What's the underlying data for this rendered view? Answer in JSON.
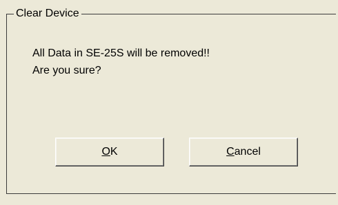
{
  "dialog": {
    "group_title": "Clear Device",
    "message_line1": "All Data in SE-25S will be removed!!",
    "message_line2": "Are you sure?",
    "buttons": {
      "ok": {
        "accel": "O",
        "rest": "K"
      },
      "cancel": {
        "accel": "C",
        "rest": "ancel"
      }
    }
  }
}
